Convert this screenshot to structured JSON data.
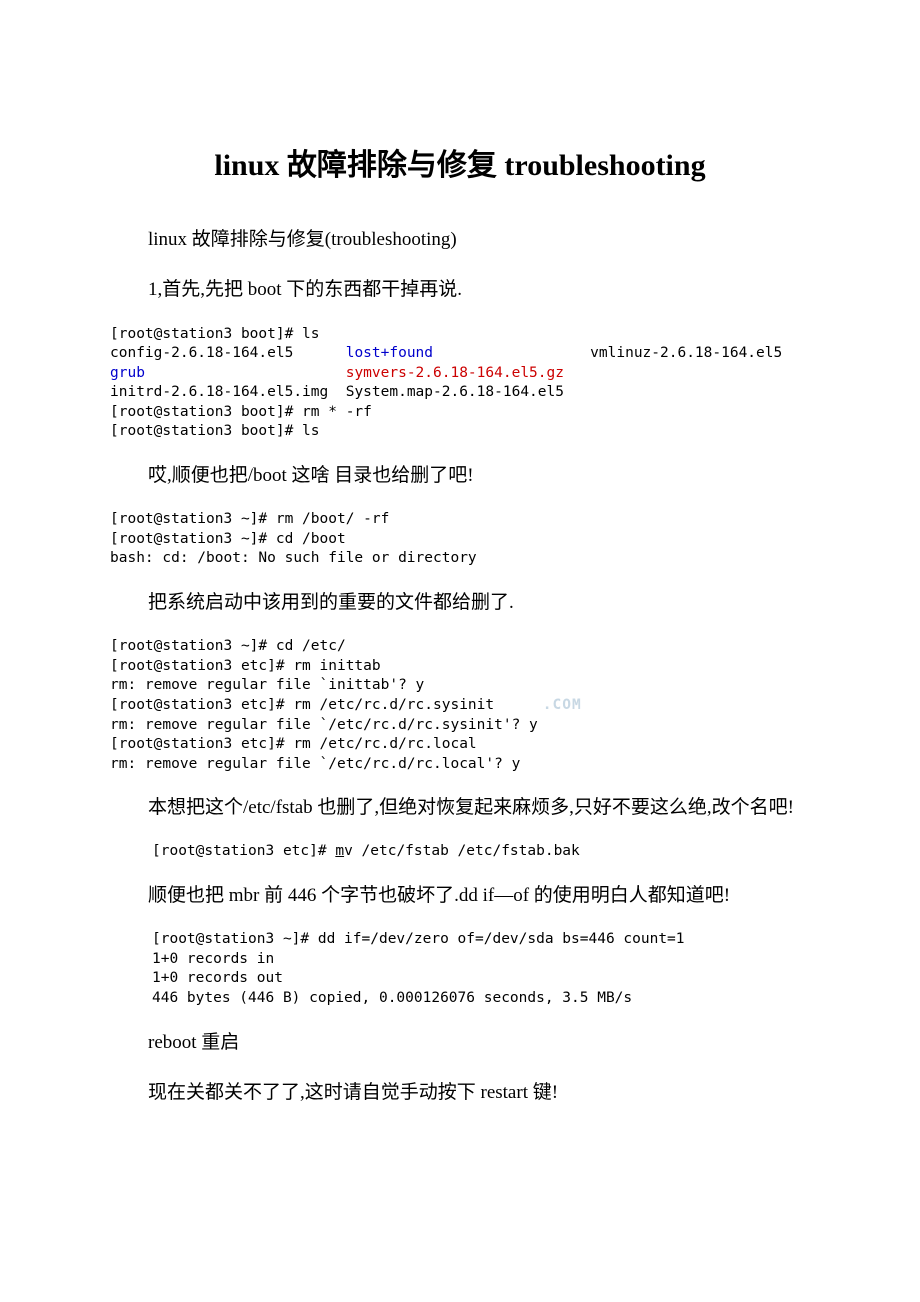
{
  "title": "linux 故障排除与修复 troubleshooting",
  "p1": "linux 故障排除与修复(troubleshooting)",
  "p2": "1,首先,先把 boot 下的东西都干掉再说.",
  "term1": {
    "l1_prompt": "[root@station3 boot]# ls",
    "l2_a": "config-2.6.18-164.el5",
    "l2_b": "lost+found",
    "l2_c": "vmlinuz-2.6.18-164.el5",
    "l3_a": "grub",
    "l3_b": "symvers-2.6.18-164.el5.gz",
    "l4_a": "initrd-2.6.18-164.el5.img",
    "l4_b": "System.map-2.6.18-164.el5",
    "l5": "[root@station3 boot]# rm * -rf",
    "l6": "[root@station3 boot]# ls"
  },
  "p3": "哎,顺便也把/boot 这啥 目录也给删了吧!",
  "term2": {
    "l1": "[root@station3 ~]# rm /boot/ -rf",
    "l2": "[root@station3 ~]# cd /boot",
    "l3": "bash: cd: /boot: No such file or directory"
  },
  "p4": "把系统启动中该用到的重要的文件都给删了.",
  "term3": {
    "l1": "[root@station3 ~]# cd /etc/",
    "l2": "[root@station3 etc]# rm inittab",
    "l3": "rm: remove regular file `inittab'? y",
    "l4": "[root@station3 etc]# rm /etc/rc.d/rc.sysinit",
    "wm": "     .COM",
    "l5": "rm: remove regular file `/etc/rc.d/rc.sysinit'? y",
    "l6": "[root@station3 etc]# rm /etc/rc.d/rc.local",
    "l7": "rm: remove regular file `/etc/rc.d/rc.local'? y"
  },
  "p5": "本想把这个/etc/fstab 也删了,但绝对恢复起来麻烦多,只好不要这么绝,改个名吧!",
  "term4": {
    "l1a": "[root@station3 etc]# ",
    "l1b": "m",
    "l1c": "v /etc/fstab /etc/fstab.bak"
  },
  "p6": "顺便也把 mbr 前 446 个字节也破坏了.dd if—of 的使用明白人都知道吧!",
  "term5": {
    "l1": "[root@station3 ~]# dd if=/dev/zero of=/dev/sda bs=446 count=1",
    "l2": "1+0 records in",
    "l3": "1+0 records out",
    "l4": "446 bytes (446 B) copied, 0.000126076 seconds, 3.5 MB/s"
  },
  "p7": "reboot 重启",
  "p8": "现在关都关不了了,这时请自觉手动按下 restart 键!"
}
